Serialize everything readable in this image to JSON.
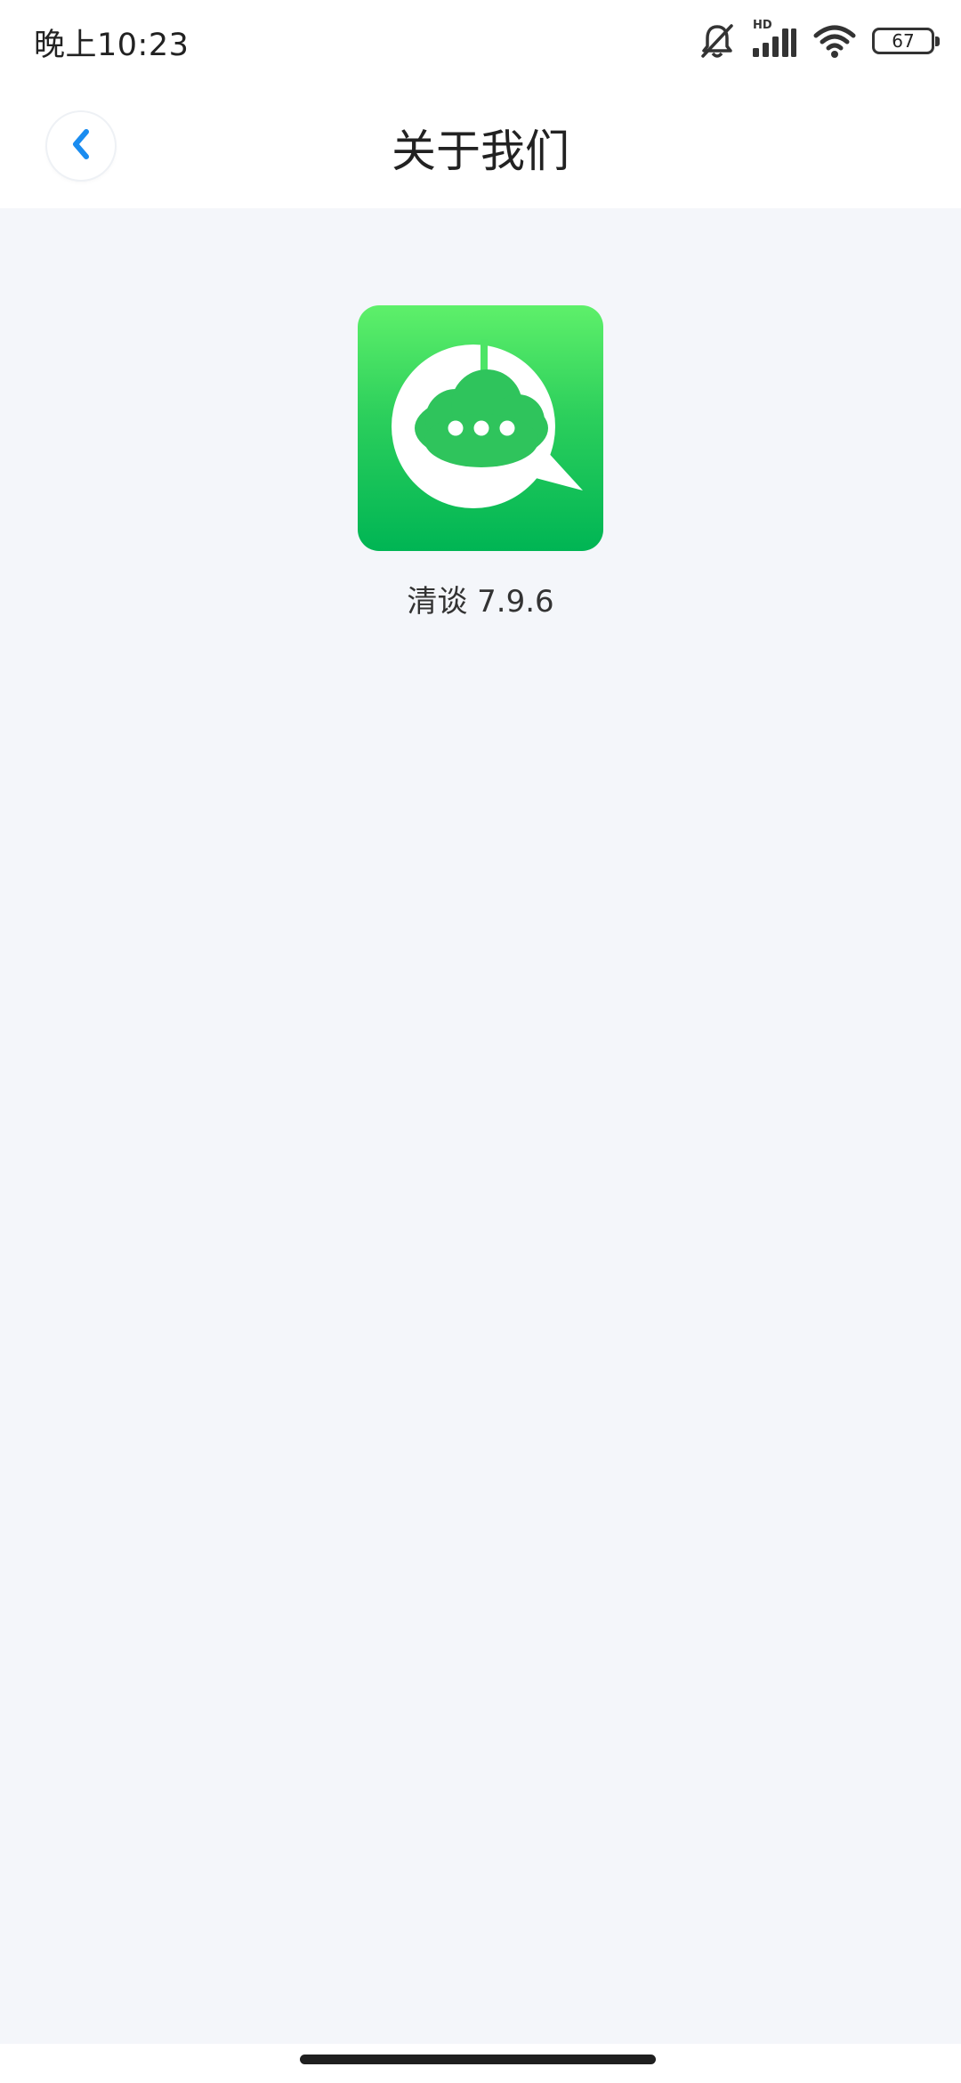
{
  "status_bar": {
    "time": "晚上10:23",
    "network_badge": "HD",
    "battery_level": "67",
    "icons": [
      "bell-muted-icon",
      "signal-icon",
      "wifi-icon",
      "battery-icon"
    ]
  },
  "header": {
    "title": "关于我们",
    "back_icon": "chevron-left-icon"
  },
  "app": {
    "logo_icon": "chat-cloud-logo-icon",
    "version_text": "清谈 7.9.6"
  },
  "colors": {
    "accent": "#1a8cf0",
    "logo_green_top": "#5ef06a",
    "logo_green_bottom": "#00b554",
    "background": "#f4f6fa"
  }
}
